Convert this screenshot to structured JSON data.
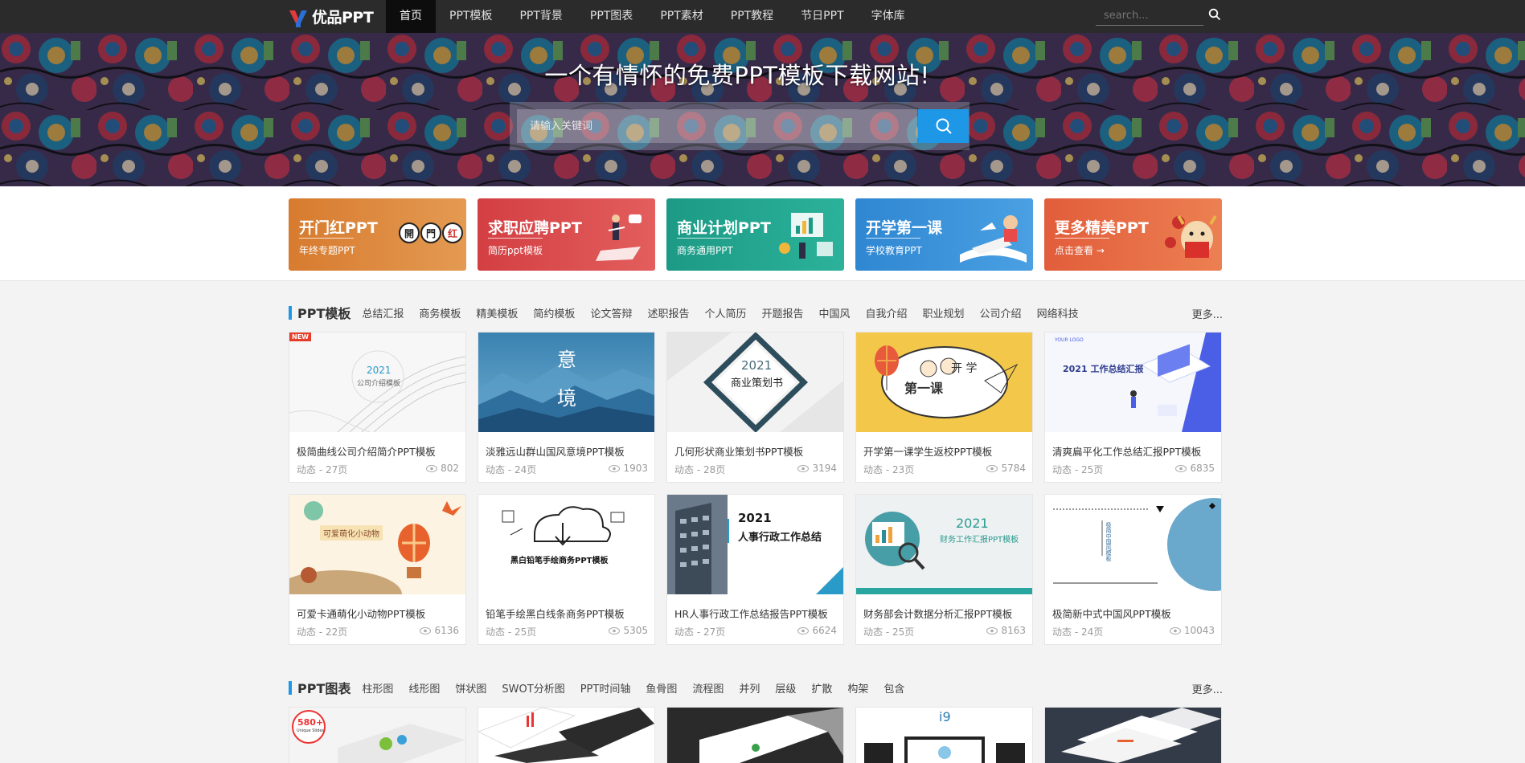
{
  "brand": {
    "name": "优品PPT"
  },
  "nav": {
    "items": [
      "首页",
      "PPT模板",
      "PPT背景",
      "PPT图表",
      "PPT素材",
      "PPT教程",
      "节日PPT",
      "字体库"
    ],
    "search_placeholder": "search..."
  },
  "hero": {
    "title": "一个有情怀的免费PPT模板下载网站!",
    "search_placeholder": "请输入关键词"
  },
  "banners": [
    {
      "title": "开门红PPT",
      "subtitle": "年终专题PPT",
      "art": "开門红",
      "color": "#d98438"
    },
    {
      "title": "求职应聘PPT",
      "subtitle": "简历ppt模板",
      "color": "#d9474a"
    },
    {
      "title": "商业计划PPT",
      "subtitle": "商务通用PPT",
      "color": "#21a08a"
    },
    {
      "title": "开学第一课",
      "subtitle": "学校教育PPT",
      "color": "#3a8fd6"
    },
    {
      "title": "更多精美PPT",
      "subtitle": "点击查看 →",
      "color": "#e2663f"
    }
  ],
  "section_templates": {
    "title": "PPT模板",
    "tags": [
      "总结汇报",
      "商务模板",
      "精美模板",
      "简约模板",
      "论文答辩",
      "述职报告",
      "个人简历",
      "开题报告",
      "中国风",
      "自我介绍",
      "职业规划",
      "公司介绍",
      "网络科技"
    ],
    "more": "更多...",
    "new_badge": "NEW",
    "cards": [
      {
        "title": "极简曲线公司介绍简介PPT模板",
        "meta": "动态 - 27页",
        "views": "802",
        "thumb_text": "2021",
        "thumb_text2": "公司介绍模板"
      },
      {
        "title": "淡雅远山群山国风意境PPT模板",
        "meta": "动态 - 24页",
        "views": "1903",
        "thumb_text": "意",
        "thumb_text2": "境"
      },
      {
        "title": "几何形状商业策划书PPT模板",
        "meta": "动态 - 28页",
        "views": "3194",
        "thumb_text": "2021",
        "thumb_text2": "商业策划书"
      },
      {
        "title": "开学第一课学生返校PPT模板",
        "meta": "动态 - 23页",
        "views": "5784",
        "thumb_text": "开 学",
        "thumb_text2": "第一课"
      },
      {
        "title": "清爽扁平化工作总结汇报PPT模板",
        "meta": "动态 - 25页",
        "views": "6835",
        "thumb_text": "2021 工作总结汇报",
        "thumb_text2": "YOUR LOGO"
      },
      {
        "title": "可爱卡通萌化小动物PPT模板",
        "meta": "动态 - 22页",
        "views": "6136",
        "thumb_text": "可爱萌化小动物"
      },
      {
        "title": "铅笔手绘黑白线条商务PPT模板",
        "meta": "动态 - 25页",
        "views": "5305",
        "thumb_text": "黑白铅笔手绘商务PPT模板"
      },
      {
        "title": "HR人事行政工作总结报告PPT模板",
        "meta": "动态 - 27页",
        "views": "6624",
        "thumb_text": "2021",
        "thumb_text2": "人事行政工作总结"
      },
      {
        "title": "财务部会计数据分析汇报PPT模板",
        "meta": "动态 - 25页",
        "views": "8163",
        "thumb_text": "2021",
        "thumb_text2": "财务工作汇报PPT模板"
      },
      {
        "title": "极简新中式中国风PPT模板",
        "meta": "动态 - 24页",
        "views": "10043",
        "thumb_text": "极简中国风模板"
      }
    ]
  },
  "section_charts": {
    "title": "PPT图表",
    "tags": [
      "柱形图",
      "线形图",
      "饼状图",
      "SWOT分析图",
      "PPT时间轴",
      "鱼骨图",
      "流程图",
      "并列",
      "层级",
      "扩散",
      "构架",
      "包含"
    ],
    "more": "更多...",
    "thumbs": [
      {
        "badge": "580+",
        "badge_sub": "Unique Slides"
      },
      {},
      {},
      {
        "label": "i9"
      },
      {}
    ]
  },
  "colors": {
    "accent": "#1e97e6",
    "topbar": "#2b2b2b",
    "nav_active": "#0d0d0d"
  }
}
